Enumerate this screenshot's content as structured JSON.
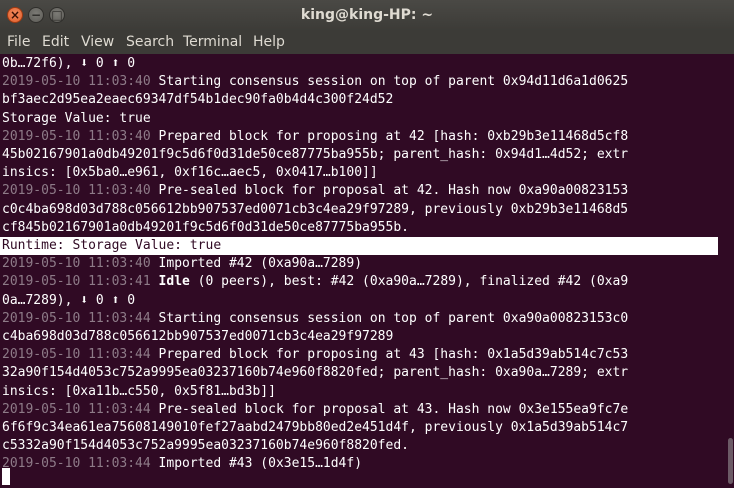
{
  "window": {
    "title": "king@king-HP: ~",
    "close_glyph": "×",
    "minimize_glyph": "−",
    "maximize_glyph": "□"
  },
  "menu": [
    "File",
    "Edit",
    "View",
    "Search",
    "Terminal",
    "Help"
  ],
  "terminal": {
    "lines": [
      {
        "ts": "",
        "text": "0b…72f6), ⬇ 0 ⬆ 0",
        "bold": "",
        "rest": ""
      },
      {
        "ts": "2019-05-10 11:03:40",
        "text": " Starting consensus session on top of parent 0x94d11d6a1d0625",
        "bold": "",
        "rest": ""
      },
      {
        "ts": "",
        "text": "bf3aec2d95ea2eaec69347df54b1dec90fa0b4d4c300f24d52",
        "bold": "",
        "rest": ""
      },
      {
        "ts": "",
        "text": "Storage Value: true",
        "bold": "",
        "rest": ""
      },
      {
        "ts": "2019-05-10 11:03:40",
        "text": " Prepared block for proposing at 42 [hash: 0xb29b3e11468d5cf8",
        "bold": "",
        "rest": ""
      },
      {
        "ts": "",
        "text": "45b02167901a0db49201f9c5d6f0d31de50ce87775ba955b; parent_hash: 0x94d1…4d52; extr",
        "bold": "",
        "rest": ""
      },
      {
        "ts": "",
        "text": "insics: [0x5ba0…e961, 0xf16c…aec5, 0x0417…b100]]",
        "bold": "",
        "rest": ""
      },
      {
        "ts": "2019-05-10 11:03:40",
        "text": " Pre-sealed block for proposal at 42. Hash now 0xa90a00823153",
        "bold": "",
        "rest": ""
      },
      {
        "ts": "",
        "text": "c0c4ba698d03d788c056612bb907537ed0071cb3c4ea29f97289, previously 0xb29b3e11468d5",
        "bold": "",
        "rest": ""
      },
      {
        "ts": "",
        "text": "cf845b02167901a0db49201f9c5d6f0d31de50ce87775ba955b.",
        "bold": "",
        "rest": ""
      },
      {
        "ts": "",
        "text": "Runtime: Storage Value: true",
        "bold": "",
        "rest": "",
        "highlight": true
      },
      {
        "ts": "2019-05-10 11:03:40",
        "text": " Imported #42 (0xa90a…7289)",
        "bold": "",
        "rest": ""
      },
      {
        "ts": "2019-05-10 11:03:41",
        "text": " ",
        "bold": "Idle",
        "rest": " (0 peers), best: #42 (0xa90a…7289), finalized #42 (0xa9"
      },
      {
        "ts": "",
        "text": "0a…7289), ⬇ 0 ⬆ 0",
        "bold": "",
        "rest": ""
      },
      {
        "ts": "2019-05-10 11:03:44",
        "text": " Starting consensus session on top of parent 0xa90a00823153c0",
        "bold": "",
        "rest": ""
      },
      {
        "ts": "",
        "text": "c4ba698d03d788c056612bb907537ed0071cb3c4ea29f97289",
        "bold": "",
        "rest": ""
      },
      {
        "ts": "2019-05-10 11:03:44",
        "text": " Prepared block for proposing at 43 [hash: 0x1a5d39ab514c7c53",
        "bold": "",
        "rest": ""
      },
      {
        "ts": "",
        "text": "32a90f154d4053c752a9995ea03237160b74e960f8820fed; parent_hash: 0xa90a…7289; extr",
        "bold": "",
        "rest": ""
      },
      {
        "ts": "",
        "text": "insics: [0xa11b…c550, 0x5f81…bd3b]]",
        "bold": "",
        "rest": ""
      },
      {
        "ts": "2019-05-10 11:03:44",
        "text": " Pre-sealed block for proposal at 43. Hash now 0x3e155ea9fc7e",
        "bold": "",
        "rest": ""
      },
      {
        "ts": "",
        "text": "6f6f9c34ea61ea75608149010fef27aabd2479bb80ed2e451d4f, previously 0x1a5d39ab514c7",
        "bold": "",
        "rest": ""
      },
      {
        "ts": "",
        "text": "c5332a90f154d4053c752a9995ea03237160b74e960f8820fed.",
        "bold": "",
        "rest": ""
      },
      {
        "ts": "2019-05-10 11:03:44",
        "text": " Imported #43 (0x3e15…1d4f)",
        "bold": "",
        "rest": ""
      }
    ]
  }
}
